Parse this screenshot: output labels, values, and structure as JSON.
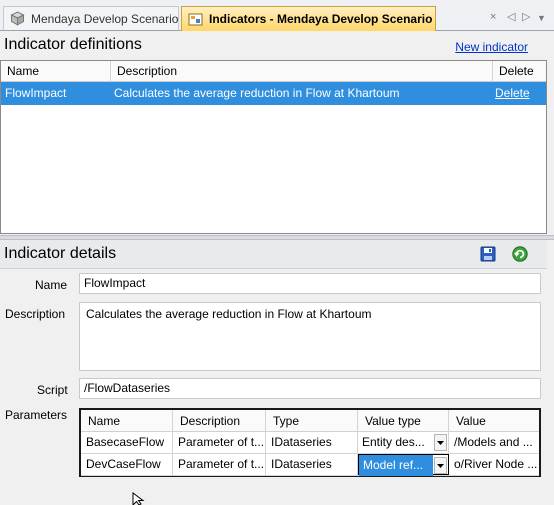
{
  "tabs": [
    {
      "label": "Mendaya Develop Scenario",
      "icon": "scenario-icon",
      "active": false
    },
    {
      "label": "Indicators - Mendaya Develop Scenario",
      "icon": "indicator-tab-icon",
      "active": true
    }
  ],
  "tab_nav": {
    "close": "×",
    "prev": "◁",
    "next": "▷",
    "more": "▼"
  },
  "definitions": {
    "title": "Indicator definitions",
    "new_link": "New indicator",
    "columns": [
      "Name",
      "Description",
      "Delete"
    ],
    "rows": [
      {
        "name": "FlowImpact",
        "description": "Calculates the average reduction in Flow at Khartoum",
        "delete": "Delete",
        "selected": true
      }
    ]
  },
  "details": {
    "title": "Indicator details",
    "save_icon": "save-icon",
    "refresh_icon": "refresh-icon",
    "labels": {
      "name": "Name",
      "description": "Description",
      "script": "Script",
      "parameters": "Parameters"
    },
    "name_value": "FlowImpact",
    "description_value": "Calculates the average reduction in Flow at Khartoum",
    "script_value": "/FlowDataseries",
    "parameters": {
      "columns": [
        "Name",
        "Description",
        "Type",
        "Value type",
        "Value"
      ],
      "rows": [
        {
          "name": "BasecaseFlow",
          "description": "Parameter of t...",
          "type": "IDataseries",
          "value_type": "Entity des...",
          "value": "/Models and ...",
          "selected": false
        },
        {
          "name": "DevCaseFlow",
          "description": "Parameter of t...",
          "type": "IDataseries",
          "value_type": "Model ref...",
          "value": "o/River Node ...",
          "selected": true
        }
      ]
    }
  },
  "colors": {
    "accent": "#2f8fde",
    "active_tab": "#ffd86a",
    "link": "#0033cc"
  }
}
